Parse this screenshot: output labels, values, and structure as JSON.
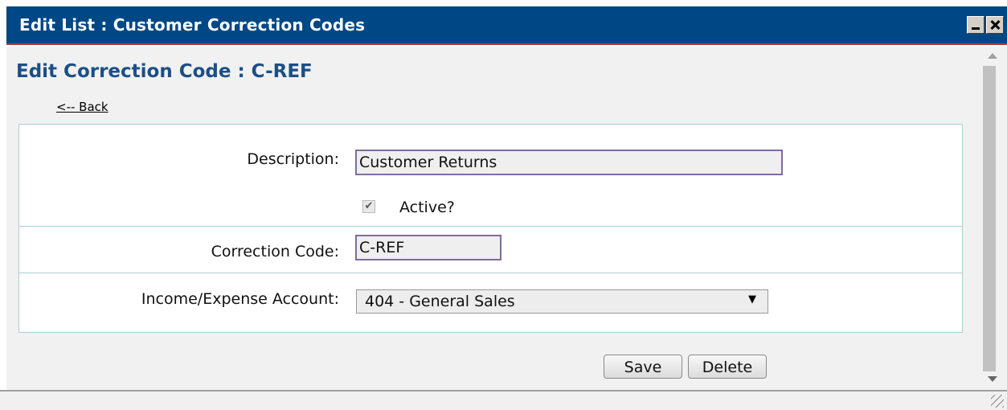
{
  "window": {
    "title": "Edit List : Customer Correction Codes"
  },
  "page": {
    "heading": "Edit Correction Code : C-REF",
    "back_link": "<-- Back"
  },
  "form": {
    "description_label": "Description:",
    "description_value": "Customer Returns",
    "active_label": "Active?",
    "active_checked": true,
    "correction_code_label": "Correction Code:",
    "correction_code_value": "C-REF",
    "account_label": "Income/Expense Account:",
    "account_selected": "404 - General Sales"
  },
  "actions": {
    "save_label": "Save",
    "delete_label": "Delete"
  },
  "colors": {
    "titlebar": "#004785",
    "heading": "#1b4f86",
    "form_border": "#a8cfd0"
  }
}
